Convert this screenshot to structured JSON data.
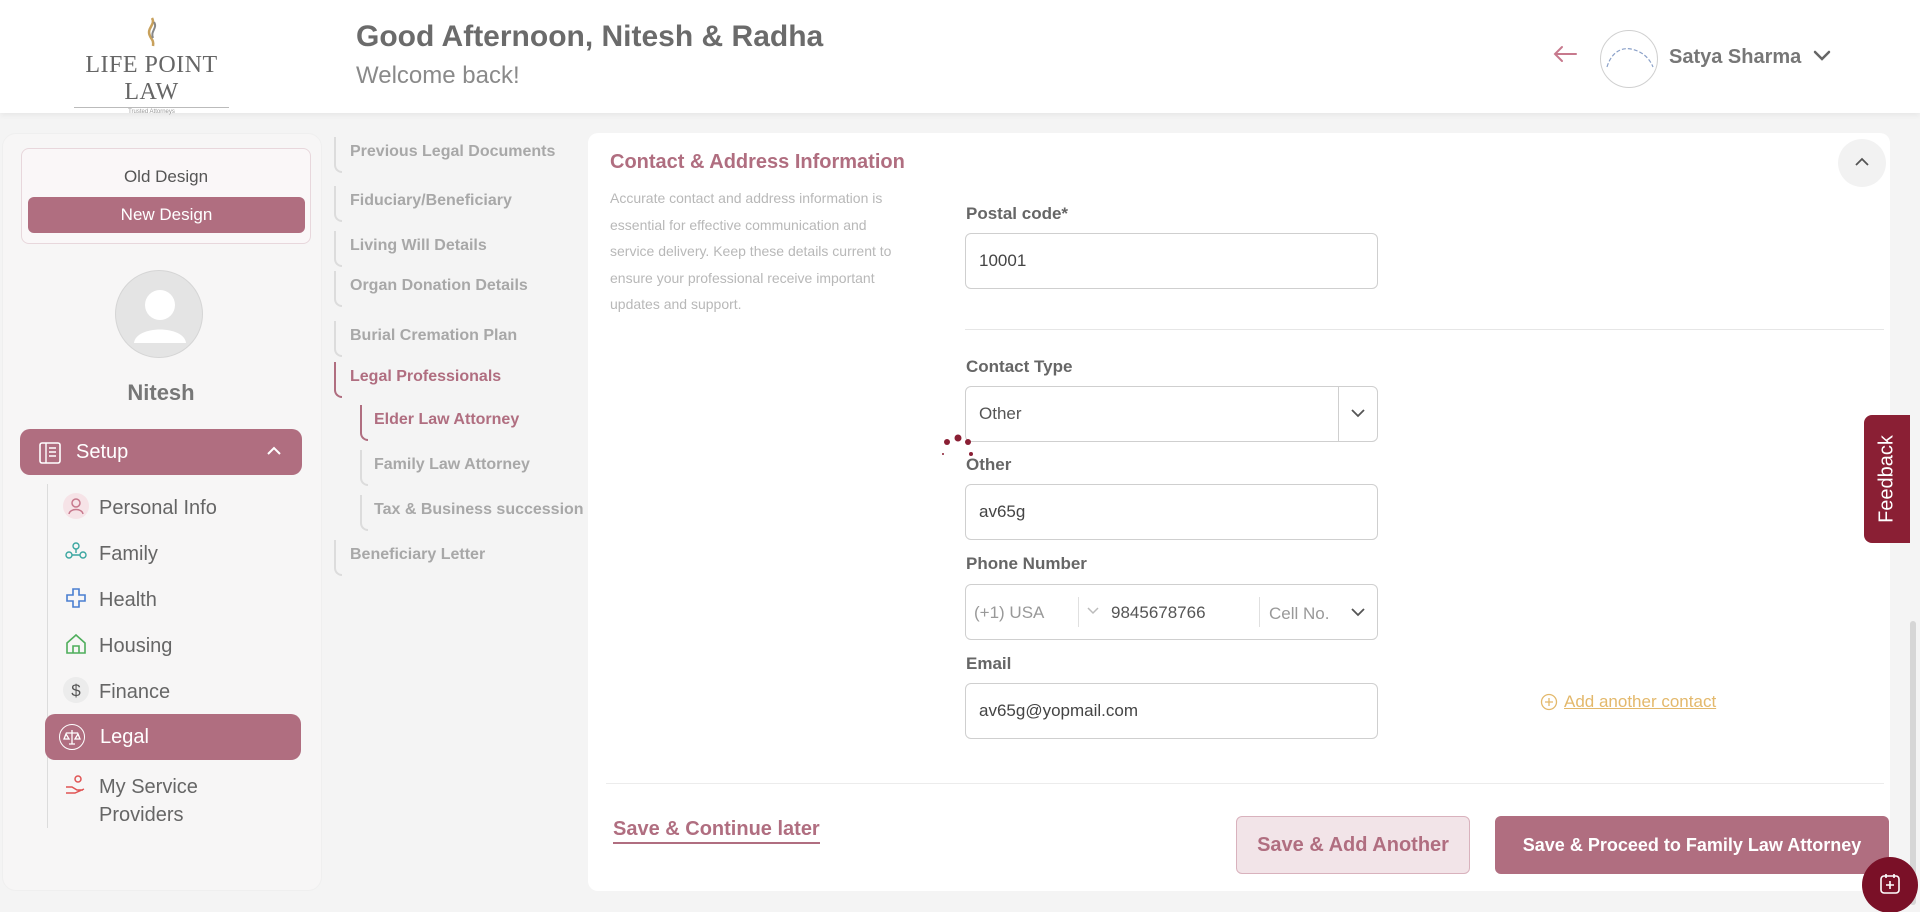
{
  "header": {
    "logo_text": "LIFE POINT LAW",
    "logo_tagline": "Trusted Attorneys",
    "greeting": "Good Afternoon, Nitesh & Radha",
    "welcome": "Welcome back!",
    "user_name": "Satya Sharma"
  },
  "sidebar": {
    "old_design": "Old Design",
    "new_design": "New Design",
    "profile_name": "Nitesh",
    "setup_label": "Setup",
    "items": [
      {
        "label": "Personal Info",
        "icon": "person-icon"
      },
      {
        "label": "Family",
        "icon": "family-icon"
      },
      {
        "label": "Health",
        "icon": "health-cross-icon"
      },
      {
        "label": "Housing",
        "icon": "house-icon"
      },
      {
        "label": "Finance",
        "icon": "dollar-icon"
      },
      {
        "label": "Legal",
        "icon": "scales-icon"
      },
      {
        "label": "My Service Providers",
        "icon": "service-provider-icon"
      }
    ],
    "active_item": "Legal"
  },
  "steps": {
    "items": [
      "Previous Legal Documents",
      "Fiduciary/Beneficiary",
      "Living Will Details",
      "Organ Donation Details",
      "Burial Cremation Plan",
      "Legal Professionals",
      "Beneficiary Letter"
    ],
    "subitems": [
      "Elder Law Attorney",
      "Family Law Attorney",
      "Tax & Business succession"
    ],
    "active_step": "Legal Professionals",
    "active_substep": "Elder Law Attorney"
  },
  "form": {
    "section_title": "Contact & Address Information",
    "section_desc": "Accurate contact and address information is essential for effective communication and service delivery. Keep these details current to ensure your professional receive important updates and support.",
    "postal_label": "Postal code*",
    "postal_value": "10001",
    "contact_type_label": "Contact Type",
    "contact_type_value": "Other",
    "other_label": "Other",
    "other_value": "av65g",
    "phone_label": "Phone Number",
    "phone_country": "(+1) USA",
    "phone_number": "9845678766",
    "phone_type": "Cell No.",
    "email_label": "Email",
    "email_value": "av65g@yopmail.com",
    "add_contact": "Add another contact"
  },
  "actions": {
    "save_later": "Save & Continue later",
    "save_add_another": "Save & Add Another",
    "save_proceed": "Save & Proceed to Family Law Attorney"
  },
  "feedback": "Feedback",
  "colors": {
    "accent": "#b06e80",
    "dark_accent": "#8a1f34",
    "link_gold": "#e3b86b"
  }
}
